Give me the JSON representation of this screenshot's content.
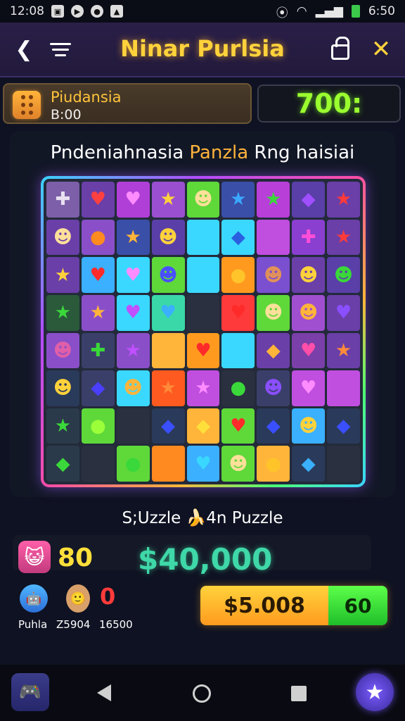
{
  "status_bar": {
    "time_left": "12:08",
    "time_right": "6:50"
  },
  "header": {
    "title": "Ninar Purlsia"
  },
  "info": {
    "player_name": "Piudansia",
    "player_sub": "B:00",
    "score": "700:"
  },
  "puzzle": {
    "title_part1": "Pndeniahnasia ",
    "title_part2": "Panzla",
    "title_part3": " Rng haisiai",
    "grid": [
      [
        {
          "bg": "#7c5fa8",
          "g": "✚",
          "c": "#e8e0f0"
        },
        {
          "bg": "#6a3fa8",
          "g": "♥",
          "c": "#ff4040"
        },
        {
          "bg": "#b03fd8",
          "g": "♥",
          "c": "#ff8cff"
        },
        {
          "bg": "#9a4fd0",
          "g": "★",
          "c": "#ffd23b"
        },
        {
          "bg": "#5fd83a",
          "g": "☻",
          "c": "#ffe09a"
        },
        {
          "bg": "#3a4fa8",
          "g": "★",
          "c": "#3aa8ff"
        },
        {
          "bg": "#b83fd8",
          "g": "★",
          "c": "#3ad83a"
        },
        {
          "bg": "#5a3fa8",
          "g": "◆",
          "c": "#a04fff"
        },
        {
          "bg": "#6a3fa8",
          "g": "★",
          "c": "#ff3a3a"
        }
      ],
      [
        {
          "bg": "#6a3fa8",
          "g": "☻",
          "c": "#ffe09a"
        },
        {
          "bg": "#8a4fc8",
          "g": "●",
          "c": "#ff8a1f"
        },
        {
          "bg": "#3a4fa8",
          "g": "★",
          "c": "#ffb43a"
        },
        {
          "bg": "#5a3fa8",
          "g": "☻",
          "c": "#ffd23b"
        },
        {
          "bg": "#3ad8ff",
          "g": "",
          "c": "#ffffff"
        },
        {
          "bg": "#3ad8ff",
          "g": "◆",
          "c": "#2a5fe0"
        },
        {
          "bg": "#c04fe0",
          "g": "",
          "c": "#ffffff"
        },
        {
          "bg": "#8a3fd0",
          "g": "✚",
          "c": "#ff4fd8"
        },
        {
          "bg": "#6a3fa8",
          "g": "★",
          "c": "#ff3a3a"
        }
      ],
      [
        {
          "bg": "#6a3fa8",
          "g": "★",
          "c": "#ffd23b"
        },
        {
          "bg": "#3ab0ff",
          "g": "♥",
          "c": "#ff2a2a"
        },
        {
          "bg": "#3ad8ff",
          "g": "♥",
          "c": "#ff8cff"
        },
        {
          "bg": "#5fd83a",
          "g": "☻",
          "c": "#4a4fff"
        },
        {
          "bg": "#3ad8ff",
          "g": "",
          "c": "#ffffff"
        },
        {
          "bg": "#ff9a1f",
          "g": "●",
          "c": "#ffc42a"
        },
        {
          "bg": "#7a4fd0",
          "g": "☻",
          "c": "#e0905a"
        },
        {
          "bg": "#6a3fa8",
          "g": "☻",
          "c": "#ffd23b"
        },
        {
          "bg": "#5a3fa8",
          "g": "☻",
          "c": "#3ad83a"
        }
      ],
      [
        {
          "bg": "#2a5a3a",
          "g": "★",
          "c": "#3ad83a"
        },
        {
          "bg": "#8a4fc8",
          "g": "★",
          "c": "#ffb43a"
        },
        {
          "bg": "#3ad8ff",
          "g": "♥",
          "c": "#c04fff"
        },
        {
          "bg": "#3ad8a8",
          "g": "♥",
          "c": "#3ab0ff"
        },
        {
          "bg": "#2a3040",
          "g": "",
          "c": "#ffffff"
        },
        {
          "bg": "#ff3a3a",
          "g": "♥",
          "c": "#ff2a2a"
        },
        {
          "bg": "#5fd83a",
          "g": "☻",
          "c": "#ffe09a"
        },
        {
          "bg": "#a04fd0",
          "g": "☻",
          "c": "#ffb43a"
        },
        {
          "bg": "#6a3fa8",
          "g": "♥",
          "c": "#8a4fff"
        }
      ],
      [
        {
          "bg": "#8a4fc8",
          "g": "☻",
          "c": "#e05fa8"
        },
        {
          "bg": "#3a3f6a",
          "g": "✚",
          "c": "#3ad83a"
        },
        {
          "bg": "#8a4fc8",
          "g": "★",
          "c": "#c04fff"
        },
        {
          "bg": "#ffb43a",
          "g": "",
          "c": "#ffffff"
        },
        {
          "bg": "#ff9a1f",
          "g": "♥",
          "c": "#ff2a2a"
        },
        {
          "bg": "#3ad8ff",
          "g": "",
          "c": "#ffffff"
        },
        {
          "bg": "#6a3fa8",
          "g": "◆",
          "c": "#ffb43a"
        },
        {
          "bg": "#7a3fa8",
          "g": "♥",
          "c": "#ff4fa8"
        },
        {
          "bg": "#6a3fa8",
          "g": "★",
          "c": "#ff8a3a"
        }
      ],
      [
        {
          "bg": "#2a3a5a",
          "g": "☻",
          "c": "#ffd23b"
        },
        {
          "bg": "#3a3f6a",
          "g": "◆",
          "c": "#4a3fff"
        },
        {
          "bg": "#3ad8ff",
          "g": "☻",
          "c": "#ffb43a"
        },
        {
          "bg": "#ff5a1f",
          "g": "★",
          "c": "#ff8a3a"
        },
        {
          "bg": "#c04fe0",
          "g": "★",
          "c": "#ff8cff"
        },
        {
          "bg": "#2a3040",
          "g": "●",
          "c": "#3ad83a"
        },
        {
          "bg": "#3a3f6a",
          "g": "☻",
          "c": "#8a4fff"
        },
        {
          "bg": "#c04fe0",
          "g": "♥",
          "c": "#ff8cff"
        },
        {
          "bg": "#c04fe0",
          "g": "",
          "c": "#ffffff"
        }
      ],
      [
        {
          "bg": "#2a3a4a",
          "g": "★",
          "c": "#3ad83a"
        },
        {
          "bg": "#5fd83a",
          "g": "●",
          "c": "#9bff3a"
        },
        {
          "bg": "#2a3040",
          "g": "",
          "c": "#ffffff"
        },
        {
          "bg": "#2a3a5a",
          "g": "◆",
          "c": "#3a4fff"
        },
        {
          "bg": "#ffb43a",
          "g": "◆",
          "c": "#ffe03a"
        },
        {
          "bg": "#5fd83a",
          "g": "♥",
          "c": "#ff2a2a"
        },
        {
          "bg": "#2a3a5a",
          "g": "◆",
          "c": "#3a4fff"
        },
        {
          "bg": "#3ab0ff",
          "g": "☻",
          "c": "#ffd23b"
        },
        {
          "bg": "#2a3a5a",
          "g": "◆",
          "c": "#3a4fff"
        }
      ],
      [
        {
          "bg": "#2a3a4a",
          "g": "◆",
          "c": "#3ad83a"
        },
        {
          "bg": "#2a3040",
          "g": "",
          "c": "#ffffff"
        },
        {
          "bg": "#5fd83a",
          "g": "●",
          "c": "#3ad83a"
        },
        {
          "bg": "#ff8a1f",
          "g": "",
          "c": "#ffffff"
        },
        {
          "bg": "#3ab0ff",
          "g": "♥",
          "c": "#3ad8ff"
        },
        {
          "bg": "#5fd83a",
          "g": "☻",
          "c": "#ffe09a"
        },
        {
          "bg": "#ffb43a",
          "g": "●",
          "c": "#ffc42a"
        },
        {
          "bg": "#2a3a5a",
          "g": "◆",
          "c": "#3ab0ff"
        },
        {
          "bg": "#2a3040",
          "g": "",
          "c": "#ffffff"
        }
      ]
    ],
    "caption": "S;Uzzle 🍌4n Puzzle"
  },
  "bottom": {
    "score_left": "80",
    "big_money": "$40,000",
    "red_count": "0",
    "labels": [
      "Puhla",
      "Z5904",
      "16500"
    ],
    "buy_price": "$5.008",
    "buy_go": "60"
  },
  "icons": {
    "back": "chevron-left-icon",
    "menu": "menu-icon",
    "lock": "lock-icon",
    "close": "close-icon",
    "star": "star-icon"
  }
}
